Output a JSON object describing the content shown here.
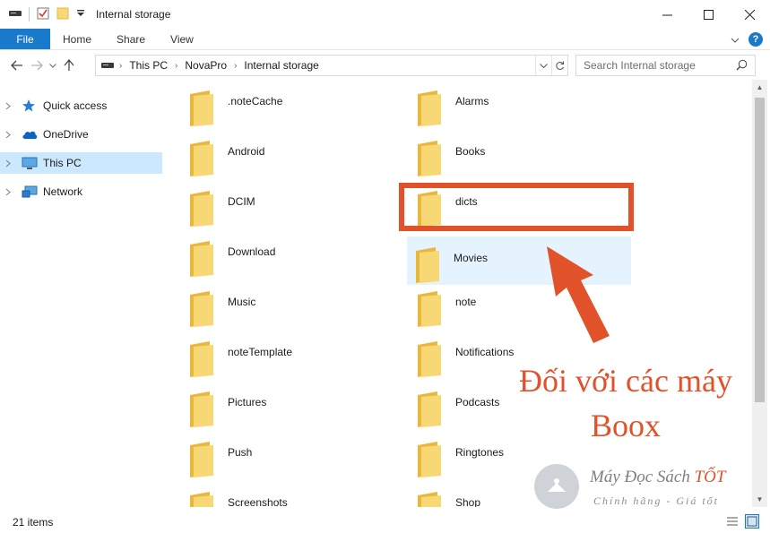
{
  "window": {
    "title": "Internal storage",
    "controls": {
      "minimize": "—",
      "maximize": "☐",
      "close": "✕"
    }
  },
  "ribbon": {
    "tabs": [
      {
        "label": "File",
        "active": true
      },
      {
        "label": "Home"
      },
      {
        "label": "Share"
      },
      {
        "label": "View"
      }
    ]
  },
  "address": {
    "breadcrumbs": [
      "This PC",
      "NovaPro",
      "Internal storage"
    ]
  },
  "search": {
    "placeholder": "Search Internal storage"
  },
  "sidebar": {
    "items": [
      {
        "label": "Quick access",
        "icon": "star-icon"
      },
      {
        "label": "OneDrive",
        "icon": "cloud-icon"
      },
      {
        "label": "This PC",
        "icon": "monitor-icon",
        "selected": true
      },
      {
        "label": "Network",
        "icon": "network-icon"
      }
    ]
  },
  "files": {
    "left": [
      ".noteCache",
      "Android",
      "DCIM",
      "Download",
      "Music",
      "noteTemplate",
      "Pictures",
      "Push",
      "Screenshots"
    ],
    "right": [
      "Alarms",
      "Books",
      "dicts",
      "Movies",
      "note",
      "Notifications",
      "Podcasts",
      "Ringtones",
      "Shop"
    ]
  },
  "status": {
    "item_count": "21 items"
  },
  "annotation": {
    "line1": "Đối với các máy",
    "line2": "Boox",
    "highlighted_item": "dicts",
    "color": "#e1522a"
  },
  "watermark": {
    "title_main": "Máy Đọc Sách ",
    "title_accent": "TỐT",
    "subtitle": "Chính hãng - Giá tốt"
  },
  "colors": {
    "accent": "#1979ca",
    "selection": "#cce8ff",
    "hover": "#e5f3ff",
    "folder": "#f8d775"
  }
}
